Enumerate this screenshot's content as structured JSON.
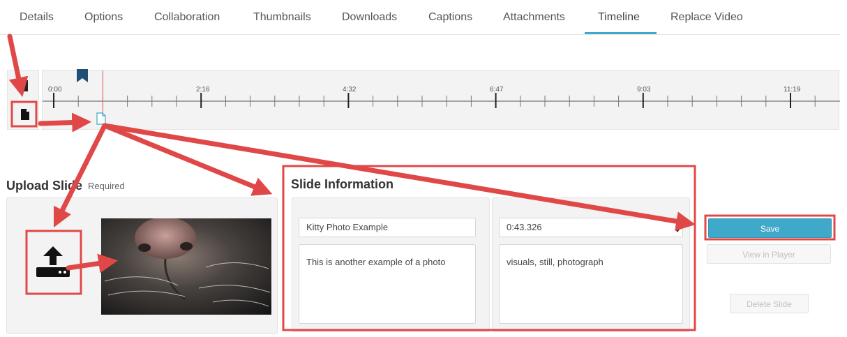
{
  "tabs": [
    {
      "label": "Details"
    },
    {
      "label": "Options"
    },
    {
      "label": "Collaboration"
    },
    {
      "label": "Thumbnails"
    },
    {
      "label": "Downloads"
    },
    {
      "label": "Captions"
    },
    {
      "label": "Attachments"
    },
    {
      "label": "Timeline",
      "active": true
    },
    {
      "label": "Replace Video"
    }
  ],
  "timeline": {
    "labels": [
      "0:00",
      "2:16",
      "4:32",
      "6:47",
      "9:03",
      "11:19"
    ]
  },
  "upload": {
    "title": "Upload Slide",
    "required": "Required"
  },
  "slide_info": {
    "title": "Slide Information",
    "name": "Kitty Photo Example",
    "description": "This is another example of a photo",
    "time": "0:43.326",
    "tags": "visuals, still, photograph"
  },
  "actions": {
    "save": "Save",
    "view_in_player": "View in Player",
    "delete_slide": "Delete Slide"
  },
  "colors": {
    "accent": "#3fa9c9",
    "annotation": "#e04848",
    "marker": "#1f4e79"
  }
}
